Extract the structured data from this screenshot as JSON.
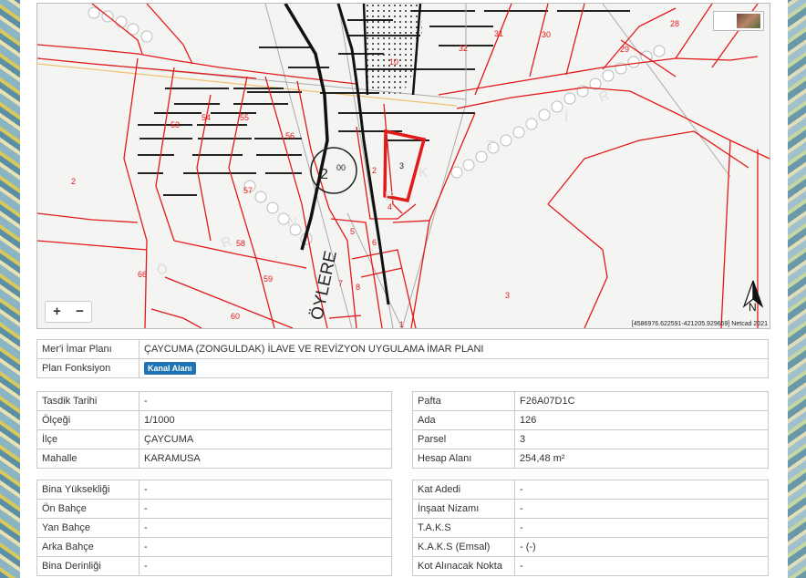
{
  "map": {
    "zoom_in": "+",
    "zoom_out": "−",
    "coords": "[4586976.622591-421205.929659] Netcad 2021",
    "north_label": "N",
    "labels": {
      "p53": "53",
      "p54": "54",
      "p55": "55",
      "p56": "56",
      "p57": "57",
      "p58": "58",
      "p59": "59",
      "p60": "60",
      "p66": "66",
      "p2a": "2",
      "p2b": "2",
      "p3a": "3",
      "p3b": "3",
      "p4": "4",
      "p5": "5",
      "p6": "6",
      "p7": "7",
      "p8": "8",
      "p1": "1",
      "p10": "10",
      "p28": "28",
      "p29": "29",
      "p30": "30",
      "p31": "31",
      "p32": "32",
      "p00": "00",
      "circle": "2",
      "road": "ÖYLERE",
      "r1": "R",
      "r2": "R",
      "o1": "Ö",
      "t1": "T",
      "e1": "E",
      "k1": "K",
      "n1": "N",
      "i1": "İ"
    }
  },
  "plan": {
    "rows": [
      {
        "label": "Mer'i İmar Planı",
        "value": "ÇAYCUMA (ZONGULDAK) İLAVE VE REVİZYON UYGULAMA İMAR PLANI"
      },
      {
        "label": "Plan Fonksiyon",
        "badge": "Kanal Alanı"
      }
    ]
  },
  "left1": [
    {
      "label": "Tasdik Tarihi",
      "value": "-"
    },
    {
      "label": "Ölçeği",
      "value": "1/1000"
    },
    {
      "label": "İlçe",
      "value": "ÇAYCUMA"
    },
    {
      "label": "Mahalle",
      "value": "KARAMUSA"
    }
  ],
  "right1": [
    {
      "label": "Pafta",
      "value": "F26A07D1C"
    },
    {
      "label": "Ada",
      "value": "126"
    },
    {
      "label": "Parsel",
      "value": "3"
    },
    {
      "label": "Hesap Alanı",
      "value": "254,48 m²"
    }
  ],
  "left2": [
    {
      "label": "Bina Yüksekliği",
      "value": "-"
    },
    {
      "label": "Ön Bahçe",
      "value": "-"
    },
    {
      "label": "Yan Bahçe",
      "value": "-"
    },
    {
      "label": "Arka Bahçe",
      "value": "-"
    },
    {
      "label": "Bina Derinliği",
      "value": "-"
    }
  ],
  "right2": [
    {
      "label": "Kat Adedi",
      "value": "-"
    },
    {
      "label": "İnşaat Nizamı",
      "value": "-"
    },
    {
      "label": "T.A.K.S",
      "value": "-"
    },
    {
      "label": "K.A.K.S (Emsal)",
      "value": "- (-)"
    },
    {
      "label": "Kot Alınacak Nokta",
      "value": "-"
    }
  ]
}
